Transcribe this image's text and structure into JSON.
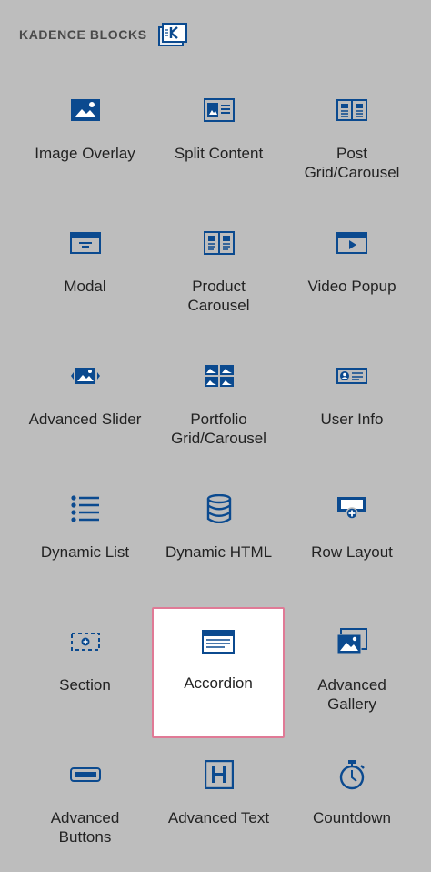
{
  "header": {
    "title": "KADENCE BLOCKS",
    "logo_icon": "kadence-logo-icon"
  },
  "colors": {
    "icon": "#0b4a8f",
    "background": "#bdbdbd",
    "selected_border": "#e07a96",
    "selected_bg": "#ffffff"
  },
  "blocks": [
    {
      "label": "Image Overlay",
      "icon": "image-overlay-icon"
    },
    {
      "label": "Split Content",
      "icon": "split-content-icon"
    },
    {
      "label": "Post Grid/Carousel",
      "icon": "post-grid-carousel-icon"
    },
    {
      "label": "Modal",
      "icon": "modal-icon"
    },
    {
      "label": "Product Carousel",
      "icon": "product-carousel-icon"
    },
    {
      "label": "Video Popup",
      "icon": "video-popup-icon"
    },
    {
      "label": "Advanced Slider",
      "icon": "advanced-slider-icon"
    },
    {
      "label": "Portfolio Grid/Carousel",
      "icon": "portfolio-grid-carousel-icon"
    },
    {
      "label": "User Info",
      "icon": "user-info-icon"
    },
    {
      "label": "Dynamic List",
      "icon": "dynamic-list-icon"
    },
    {
      "label": "Dynamic HTML",
      "icon": "dynamic-html-icon"
    },
    {
      "label": "Row Layout",
      "icon": "row-layout-icon"
    },
    {
      "label": "Section",
      "icon": "section-icon"
    },
    {
      "label": "Accordion",
      "icon": "accordion-icon",
      "selected": true
    },
    {
      "label": "Advanced Gallery",
      "icon": "advanced-gallery-icon"
    },
    {
      "label": "Advanced Buttons",
      "icon": "advanced-buttons-icon"
    },
    {
      "label": "Advanced Text",
      "icon": "advanced-text-icon"
    },
    {
      "label": "Countdown",
      "icon": "countdown-icon"
    }
  ]
}
